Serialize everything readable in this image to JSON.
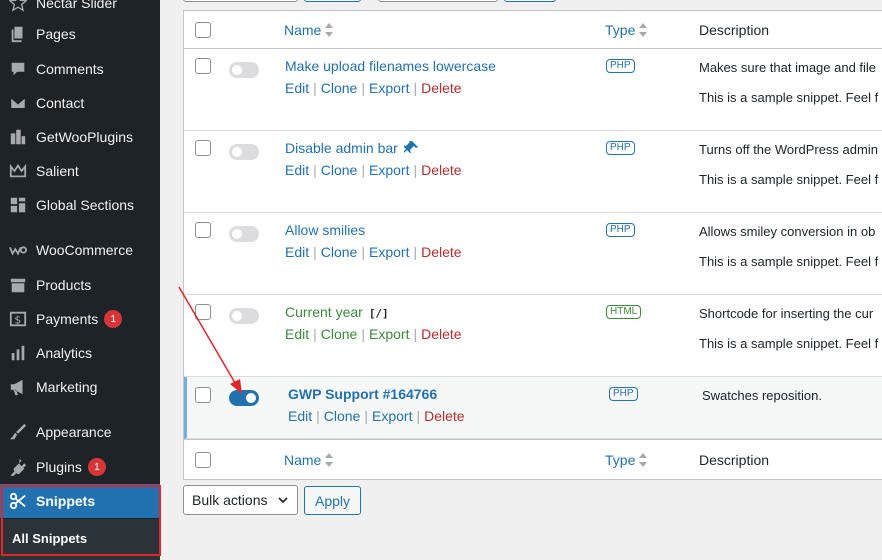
{
  "sidebar": {
    "items": [
      {
        "label": "Nectar Slider",
        "icon": "star-icon"
      },
      {
        "label": "Pages",
        "icon": "pages-icon"
      },
      {
        "label": "Comments",
        "icon": "comment-icon"
      },
      {
        "label": "Contact",
        "icon": "mail-icon"
      },
      {
        "label": "GetWooPlugins",
        "icon": "plugin-grid-icon"
      },
      {
        "label": "Salient",
        "icon": "crown-icon"
      },
      {
        "label": "Global Sections",
        "icon": "layout-icon"
      },
      {
        "label": "WooCommerce",
        "icon": "woo-icon"
      },
      {
        "label": "Products",
        "icon": "archive-icon"
      },
      {
        "label": "Payments",
        "icon": "dollar-icon",
        "badge": "1"
      },
      {
        "label": "Analytics",
        "icon": "bar-chart-icon"
      },
      {
        "label": "Marketing",
        "icon": "megaphone-icon"
      },
      {
        "label": "Appearance",
        "icon": "brush-icon"
      },
      {
        "label": "Plugins",
        "icon": "plug-icon",
        "badge": "1"
      },
      {
        "label": "Snippets",
        "icon": "scissors-icon",
        "active": true
      }
    ],
    "submenu": {
      "label": "All Snippets"
    }
  },
  "table": {
    "columns": {
      "name": "Name",
      "type": "Type",
      "description": "Description"
    },
    "actions": {
      "edit": "Edit",
      "clone": "Clone",
      "export": "Export",
      "delete": "Delete",
      "sep": "|"
    },
    "rows": [
      {
        "name": "Make upload filenames lowercase",
        "type": "PHP",
        "desc": "Makes sure that image and file",
        "desc2": "This is a sample snippet. Feel f",
        "active": false
      },
      {
        "name": "Disable admin bar",
        "type": "PHP",
        "desc": "Turns off the WordPress admin",
        "desc2": "This is a sample snippet. Feel f",
        "active": false,
        "icon": "pin-icon"
      },
      {
        "name": "Allow smilies",
        "type": "PHP",
        "desc": "Allows smiley conversion in ob",
        "desc2": "This is a sample snippet. Feel f",
        "active": false
      },
      {
        "name": "Current year",
        "name_suffix": "[/]",
        "type": "HTML",
        "desc": "Shortcode for inserting the cur",
        "desc2": "This is a sample snippet. Feel f",
        "active": false
      },
      {
        "name": "GWP Support #164766",
        "type": "PHP",
        "desc": "Swatches reposition.",
        "desc2": "",
        "active": true
      }
    ]
  },
  "bottom": {
    "bulk_actions": "Bulk actions",
    "apply": "Apply"
  },
  "colors": {
    "accent": "#2271b1",
    "sidebar_bg": "#1d2327",
    "delete": "#b32d2e",
    "html_green": "#3b8a3b",
    "highlight": "#e0262c"
  }
}
